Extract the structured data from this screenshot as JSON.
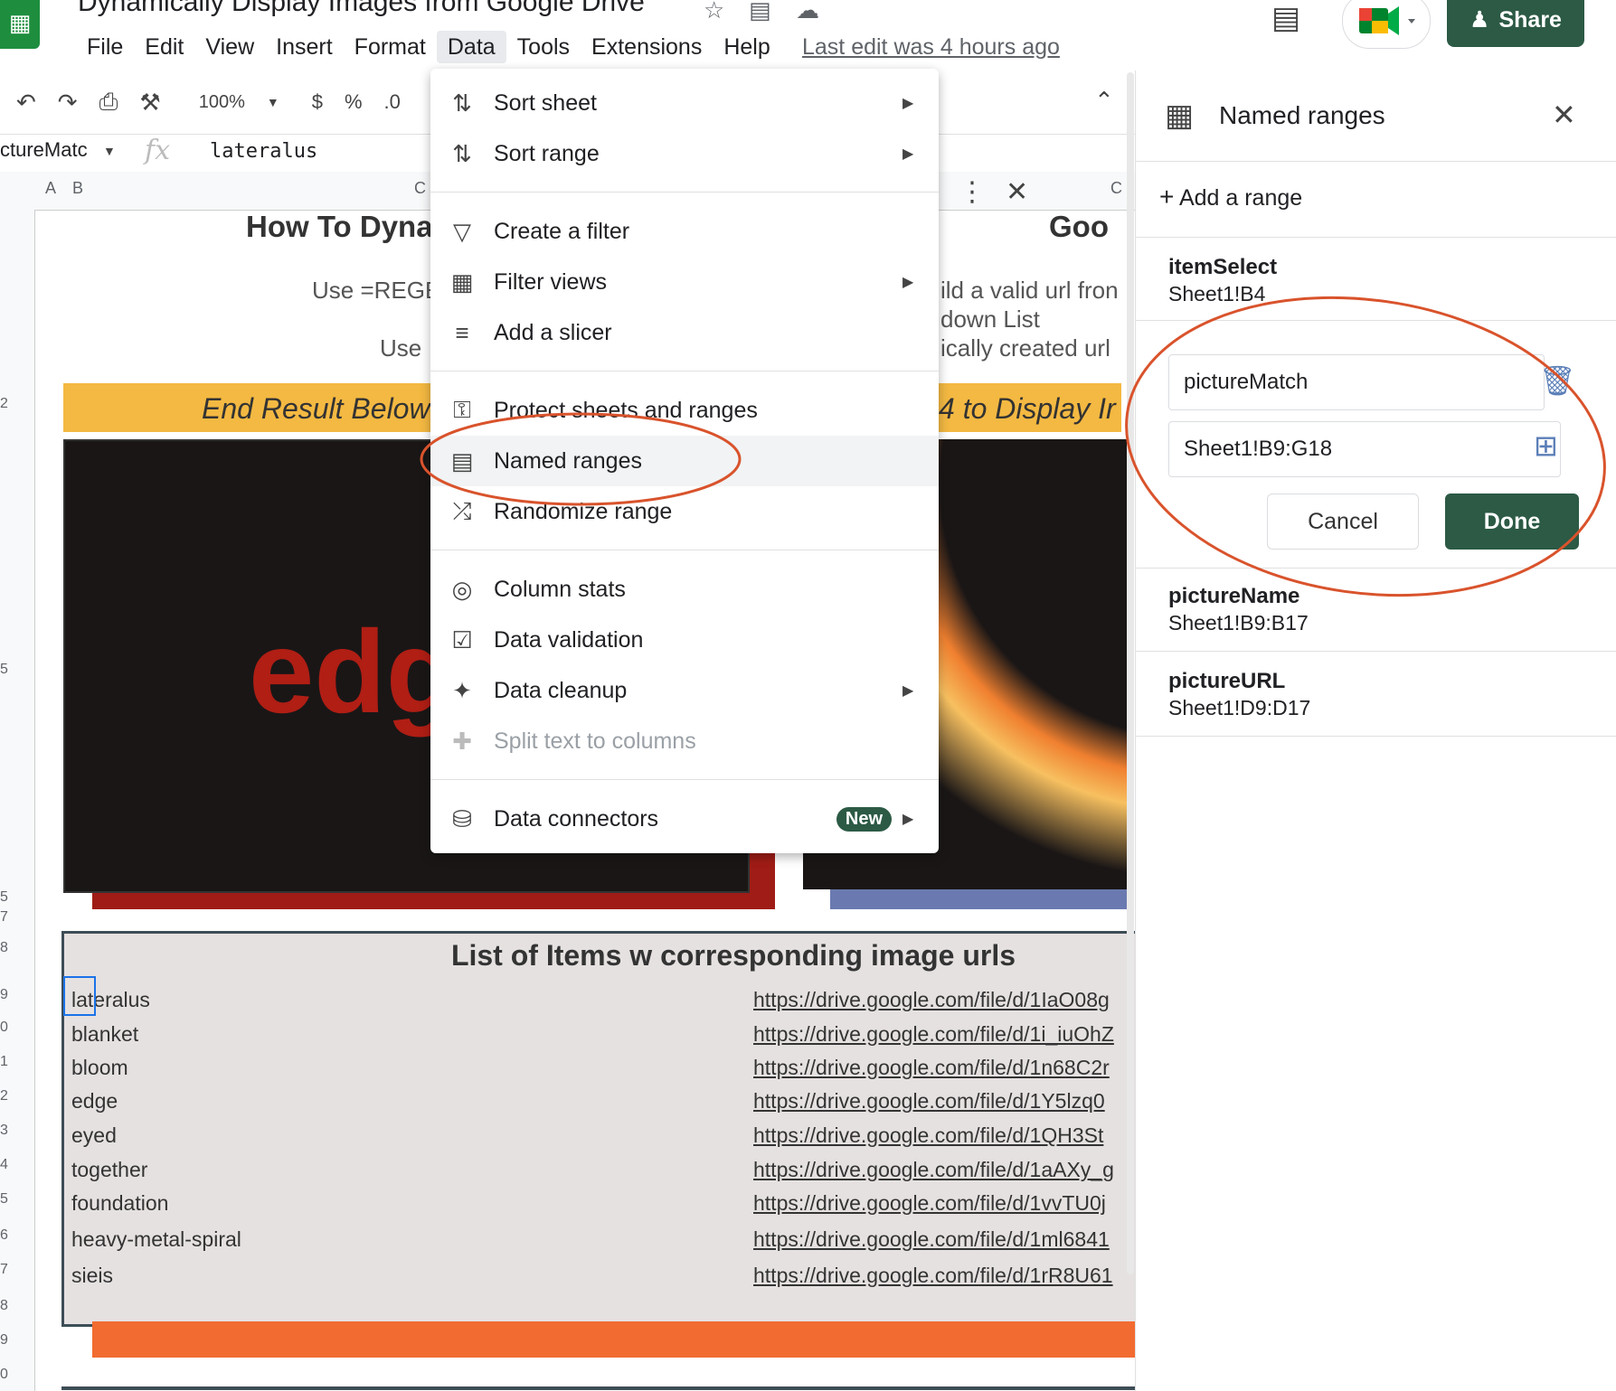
{
  "header": {
    "doc_title": "Dynamically Display Images from Google Drive",
    "share_label": "Share",
    "last_edit": "Last edit was 4 hours ago",
    "menus": [
      "File",
      "Edit",
      "View",
      "Insert",
      "Format",
      "Data",
      "Tools",
      "Extensions",
      "Help"
    ]
  },
  "toolbar": {
    "zoom": "100%",
    "currency": "$",
    "percent": "%",
    "decimal": ".0"
  },
  "formula_bar": {
    "name_box": "ctureMatc",
    "fx": "fx",
    "value": "lateralus"
  },
  "columns": [
    "A",
    "B",
    "C",
    "C"
  ],
  "rows": [
    "2",
    "5",
    "5",
    "7",
    "8",
    "9",
    "0",
    "1",
    "2",
    "3",
    "4",
    "5",
    "6",
    "7",
    "8",
    "9",
    "0"
  ],
  "sheet": {
    "title_left": "How To Dyna",
    "title_right": "Goo",
    "left_line1": "Use =REGE",
    "left_line2": "Use",
    "right_line1": "ild a valid url fron",
    "right_line2": "down List",
    "right_line3": "ically created url",
    "banner_left": "End Result Below",
    "banner_right": "4 to Display Ir",
    "image_text": "edg",
    "list_title": "List of Items w corresponding image urls",
    "items": [
      {
        "name": "lateralus",
        "url": "https://drive.google.com/file/d/1IaO08g"
      },
      {
        "name": "blanket",
        "url": "https://drive.google.com/file/d/1i_iuOhZ"
      },
      {
        "name": "bloom",
        "url": "https://drive.google.com/file/d/1n68C2r"
      },
      {
        "name": "edge",
        "url": "https://drive.google.com/file/d/1Y5lzq0"
      },
      {
        "name": "eyed",
        "url": "https://drive.google.com/file/d/1QH3St"
      },
      {
        "name": "together",
        "url": "https://drive.google.com/file/d/1aAXy_g"
      },
      {
        "name": "foundation",
        "url": "https://drive.google.com/file/d/1vvTU0j"
      },
      {
        "name": "heavy-metal-spiral",
        "url": "https://drive.google.com/file/d/1ml6841"
      },
      {
        "name": "sieis",
        "url": "https://drive.google.com/file/d/1rR8U61"
      }
    ]
  },
  "data_menu": {
    "sort_sheet": "Sort sheet",
    "sort_range": "Sort range",
    "create_filter": "Create a filter",
    "filter_views": "Filter views",
    "add_slicer": "Add a slicer",
    "protect": "Protect sheets and ranges",
    "named_ranges": "Named ranges",
    "randomize": "Randomize range",
    "column_stats": "Column stats",
    "data_validation": "Data validation",
    "data_cleanup": "Data cleanup",
    "split_text": "Split text to columns",
    "data_connectors": "Data connectors",
    "new_badge": "New"
  },
  "panel": {
    "title": "Named ranges",
    "add_range": "Add a range",
    "ranges": [
      {
        "name": "itemSelect",
        "ref": "Sheet1!B4"
      },
      {
        "name": "pictureName",
        "ref": "Sheet1!B9:B17"
      },
      {
        "name": "pictureURL",
        "ref": "Sheet1!D9:D17"
      }
    ],
    "edit_name": "pictureMatch",
    "edit_ref": "Sheet1!B9:G18",
    "cancel_label": "Cancel",
    "done_label": "Done"
  },
  "colors": {
    "accent_green": "#2c5a45",
    "annotation_red": "#d9532c",
    "banner_yellow": "#f4b942",
    "orange_bar": "#f26b30"
  }
}
